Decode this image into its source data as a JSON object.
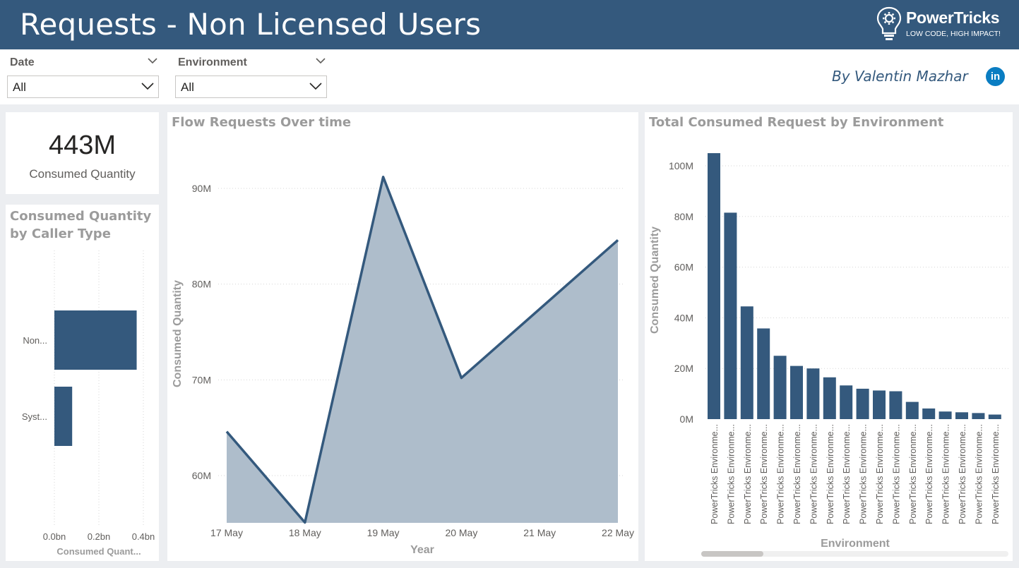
{
  "header": {
    "title": "Requests - Non Licensed Users"
  },
  "logo": {
    "name": "PowerTricks",
    "tagline": "LOW CODE, HIGH IMPACT!",
    "icon": "lightbulb-gear-icon"
  },
  "filters": {
    "date": {
      "label": "Date",
      "value": "All"
    },
    "environment": {
      "label": "Environment",
      "value": "All"
    }
  },
  "byline": "By Valentin Mazhar",
  "linkedin": {
    "icon": "linkedin-icon",
    "text": "in"
  },
  "card": {
    "value": "443M",
    "label": "Consumed Quantity"
  },
  "colors": {
    "header": "#34597d",
    "bar": "#34597d",
    "area_fill": "#aebdcb",
    "line": "#34597d"
  },
  "chart_data": [
    {
      "id": "caller",
      "type": "bar",
      "orientation": "horizontal",
      "title_lines": [
        "Consumed Quantity",
        "by Caller Type"
      ],
      "categories": [
        "Non...",
        "Syst..."
      ],
      "values": [
        0.37,
        0.08
      ],
      "xlabel": "Consumed Quant...",
      "xticks": [
        "0.0bn",
        "0.2bn",
        "0.4bn"
      ],
      "xlim": [
        0,
        0.4
      ],
      "grid": true
    },
    {
      "id": "flow",
      "type": "area",
      "title": "Flow Requests Over time",
      "categories": [
        "17 May",
        "18 May",
        "19 May",
        "20 May",
        "21 May",
        "22 May"
      ],
      "x": [
        0,
        1,
        2,
        3,
        4,
        5
      ],
      "points": [
        {
          "x": 0,
          "y": 64.6
        },
        {
          "x": 1,
          "y": 55.1
        },
        {
          "x": 2,
          "y": 91.2
        },
        {
          "x": 3,
          "y": 70.2
        },
        {
          "x": 5,
          "y": 84.6
        }
      ],
      "xlabel": "Year",
      "ylabel": "Consumed Quantity",
      "yticks": [
        {
          "value": 60,
          "label": "60M"
        },
        {
          "value": 70,
          "label": "70M"
        },
        {
          "value": 80,
          "label": "80M"
        },
        {
          "value": 90,
          "label": "90M"
        }
      ],
      "ylim": [
        55,
        97
      ],
      "grid": true
    },
    {
      "id": "env",
      "type": "bar",
      "title": "Total Consumed Request by Environment",
      "categories": [
        "PowerTricks Environme...",
        "PowerTricks Environme...",
        "PowerTricks Environme...",
        "PowerTricks Environme...",
        "PowerTricks Environme...",
        "PowerTricks Environme...",
        "PowerTricks Environme...",
        "PowerTricks Environme...",
        "PowerTricks Environme...",
        "PowerTricks Environme...",
        "PowerTricks Environme...",
        "PowerTricks Environme...",
        "PowerTricks Environme...",
        "PowerTricks Environme...",
        "PowerTricks Environme...",
        "PowerTricks Environme...",
        "PowerTricks Environme...",
        "PowerTricks Environme..."
      ],
      "values": [
        105,
        81.5,
        44.5,
        35.8,
        25,
        21,
        20,
        16.5,
        13.3,
        12,
        11.3,
        11,
        6.8,
        4.2,
        3,
        2.7,
        2.4,
        1.8
      ],
      "xlabel": "Environment",
      "ylabel": "Consumed Quantity",
      "yticks": [
        {
          "value": 0,
          "label": "0M"
        },
        {
          "value": 20,
          "label": "20M"
        },
        {
          "value": 40,
          "label": "40M"
        },
        {
          "value": 60,
          "label": "60M"
        },
        {
          "value": 80,
          "label": "80M"
        },
        {
          "value": 100,
          "label": "100M"
        }
      ],
      "ylim": [
        0,
        108
      ],
      "grid": true
    }
  ]
}
